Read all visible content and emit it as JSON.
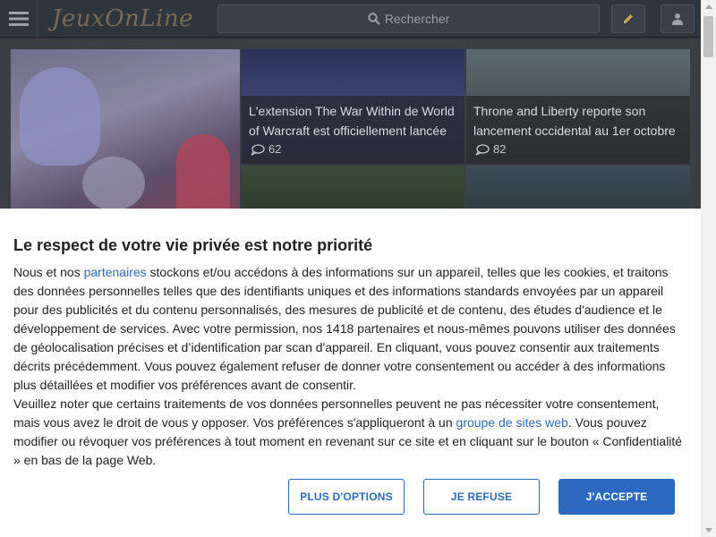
{
  "header": {
    "logo_text": "JeuxOnLine",
    "search_placeholder": "Rechercher"
  },
  "articles": [
    {
      "title": "L'extension The War Within de World of Warcraft est officiellement lancée",
      "comments": "62"
    },
    {
      "title": "Throne and Liberty reporte son lancement occidental au 1er octobre",
      "comments": "82"
    }
  ],
  "consent": {
    "heading": "Le respect de votre vie privée est notre priorité",
    "p1_a": "Nous et nos ",
    "p1_link": "partenaires",
    "p1_b": " stockons et/ou accédons à des informations sur un appareil, telles que les cookies, et traitons des données personnelles telles que des identifiants uniques et des informations standards envoyées par un appareil pour des publicités et du contenu personnalisés, des mesures de publicité et de contenu, des études d'audience et le développement de services. Avec votre permission, nos 1418 partenaires et nous-mêmes pouvons utiliser des données de géolocalisation précises et d’identification par scan d'appareil. En cliquant, vous pouvez consentir aux traitements décrits précédemment. Vous pouvez également refuser de donner votre consentement ou accéder à des informations plus détaillées et modifier vos préférences avant de consentir.",
    "p2_a": "Veuillez noter que certains traitements de vos données personnelles peuvent ne pas nécessiter votre consentement, mais vous avez le droit de vous y opposer. Vos préférences s'appliqueront à un ",
    "p2_link": "groupe de sites web",
    "p2_b": ". Vous pouvez modifier ou révoquer vos préférences à tout moment en revenant sur ce site et en cliquant sur le bouton « Confidentialité » en bas de la page Web.",
    "btn_options": "PLUS D'OPTIONS",
    "btn_refuse": "JE REFUSE",
    "btn_accept": "J'ACCEPTE"
  },
  "colors": {
    "accent": "#2c6ac2",
    "link": "#2f6db8",
    "header_bg": "#2f353d"
  }
}
